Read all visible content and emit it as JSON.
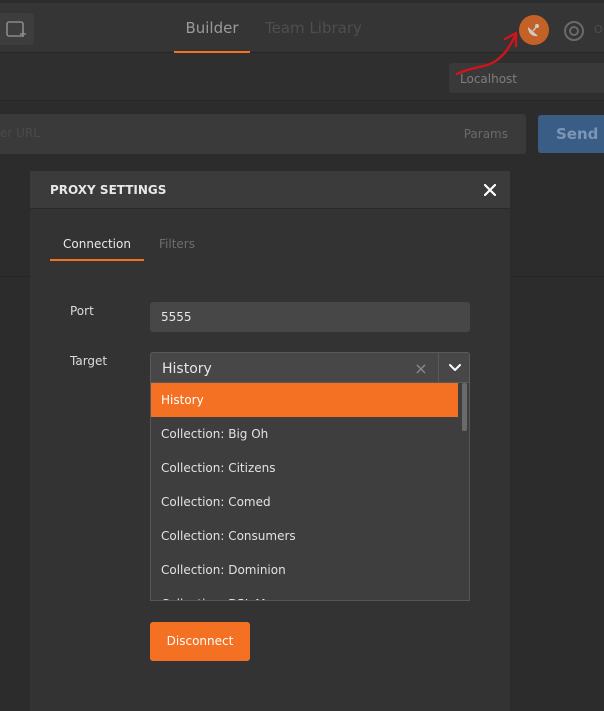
{
  "header": {
    "tabs": [
      {
        "label": "Builder"
      },
      {
        "label": "Team Library"
      }
    ],
    "sync_label": "O"
  },
  "environment": {
    "selected": "Localhost"
  },
  "request": {
    "url_ghost": "er URL",
    "params_label": "Params",
    "send_label": "Send"
  },
  "modal": {
    "title": "PROXY SETTINGS",
    "tabs": [
      {
        "label": "Connection"
      },
      {
        "label": "Filters"
      }
    ],
    "port": {
      "label": "Port",
      "value": "5555"
    },
    "target": {
      "label": "Target",
      "selected": "History",
      "options": [
        {
          "label": "History"
        },
        {
          "label": "Collection: Big Oh"
        },
        {
          "label": "Collection: Citizens"
        },
        {
          "label": "Collection: Comed"
        },
        {
          "label": "Collection: Consumers"
        },
        {
          "label": "Collection: Dominion"
        },
        {
          "label": "Collection: DPL Money"
        }
      ]
    },
    "disconnect_label": "Disconnect"
  },
  "colors": {
    "accent": "#f47023",
    "send": "#3a5d86",
    "annotation": "#d0141b"
  },
  "icons": {
    "new_tab": "new-tab-icon",
    "interceptor": "satellite-dish-icon",
    "sync": "sync-icon",
    "close": "close-icon",
    "clear": "clear-icon",
    "chevron": "chevron-down-icon"
  }
}
